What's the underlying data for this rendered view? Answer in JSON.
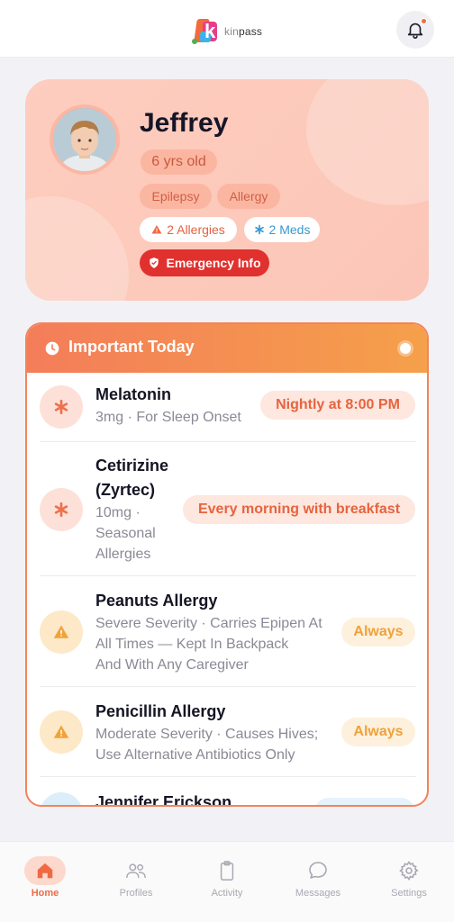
{
  "app": {
    "brand": "kinpass",
    "brand_prefix": "kin",
    "brand_suffix": "pass",
    "accent_color": "#f26b3a"
  },
  "header": {
    "notification_icon": "bell-icon",
    "has_unread": true
  },
  "profile": {
    "name": "Jeffrey",
    "age": "6 yrs old",
    "tags": [
      "Epilepsy",
      "Allergy"
    ],
    "allergies_label": "2 Allergies",
    "meds_label": "2 Meds",
    "emergency_label": "Emergency Info"
  },
  "important_today": {
    "title": "Important Today",
    "items": [
      {
        "icon": "asterisk-icon",
        "title": "Melatonin",
        "subtitle": "3mg · For Sleep Onset",
        "badge": "Nightly at 8:00 PM"
      },
      {
        "icon": "asterisk-icon",
        "title_line1": "Cetirizine",
        "title_line2": "(Zyrtec)",
        "subtitle_line1": "10mg ·",
        "subtitle_line2": "Seasonal",
        "subtitle_line3": "Allergies",
        "badge": "Every morning with breakfast"
      },
      {
        "icon": "warning-icon",
        "title": "Peanuts Allergy",
        "subtitle_line1": "Severe Severity · Carries Epipen At",
        "subtitle_line2": "All Times — Kept In Backpack",
        "subtitle_line3": "And With Any Caregiver",
        "badge": "Always"
      },
      {
        "icon": "warning-icon",
        "title": "Penicillin Allergy",
        "subtitle_line1": "Moderate Severity · Causes Hives;",
        "subtitle_line2": "Use Alternative Antibiotics Only",
        "badge": "Always"
      },
      {
        "icon": "contact-icon",
        "title": "Jennifer Erickson"
      }
    ]
  },
  "bottom_nav": {
    "items": [
      {
        "label": "Home",
        "icon": "home-icon",
        "active": true
      },
      {
        "label": "Profiles",
        "icon": "people-icon",
        "active": false
      },
      {
        "label": "Activity",
        "icon": "clipboard-icon",
        "active": false
      },
      {
        "label": "Messages",
        "icon": "chat-icon",
        "active": false
      },
      {
        "label": "Settings",
        "icon": "gear-icon",
        "active": false
      }
    ]
  }
}
